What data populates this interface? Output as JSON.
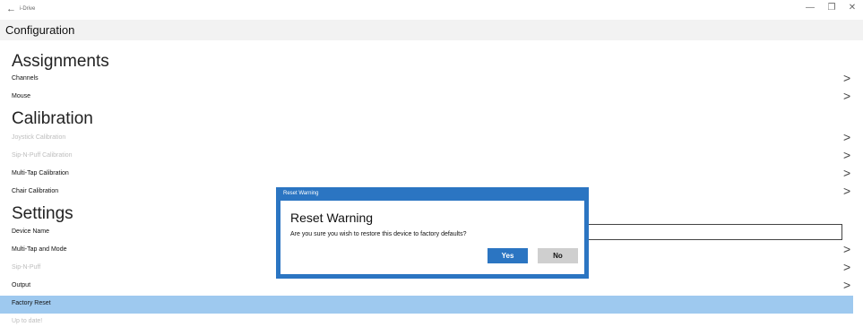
{
  "window": {
    "back_glyph": "←",
    "app_name": "i-Drive",
    "minimize_glyph": "—",
    "maximize_glyph": "❐",
    "close_glyph": "✕"
  },
  "header": {
    "title": "Configuration"
  },
  "sections": {
    "assignments": "Assignments",
    "calibration": "Calibration",
    "settings": "Settings"
  },
  "items": {
    "channels": "Channels",
    "mouse": "Mouse",
    "joystick_calibration": "Joystick Calibration",
    "sip_n_puff_calibration": "Sip-N-Puff Calibration",
    "multi_tap_calibration": "Multi-Tap Calibration",
    "chair_calibration": "Chair Calibration",
    "device_name": "Device Name",
    "multi_tap_and_mode": "Multi-Tap and Mode",
    "sip_n_puff": "Sip-N-Puff",
    "output": "Output",
    "factory_reset": "Factory Reset",
    "up_to_date": "Up to date!"
  },
  "chevron_glyph": ">",
  "dialog": {
    "title": "Reset Warning",
    "heading": "Reset Warning",
    "message": "Are you sure you wish to restore this device to factory defaults?",
    "yes_label": "Yes",
    "no_label": "No"
  },
  "colors": {
    "accent": "#2b75c2",
    "selected_row": "#9ec9ef",
    "disabled_text": "#bdbdbd"
  }
}
